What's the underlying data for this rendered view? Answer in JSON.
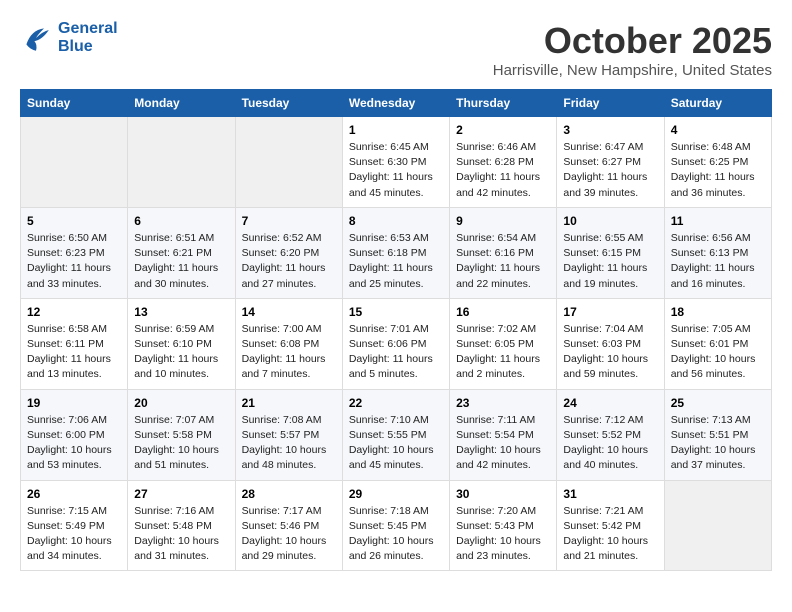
{
  "header": {
    "logo_line1": "General",
    "logo_line2": "Blue",
    "month": "October 2025",
    "location": "Harrisville, New Hampshire, United States"
  },
  "weekdays": [
    "Sunday",
    "Monday",
    "Tuesday",
    "Wednesday",
    "Thursday",
    "Friday",
    "Saturday"
  ],
  "weeks": [
    [
      {
        "num": "",
        "sunrise": "",
        "sunset": "",
        "daylight": ""
      },
      {
        "num": "",
        "sunrise": "",
        "sunset": "",
        "daylight": ""
      },
      {
        "num": "",
        "sunrise": "",
        "sunset": "",
        "daylight": ""
      },
      {
        "num": "1",
        "sunrise": "Sunrise: 6:45 AM",
        "sunset": "Sunset: 6:30 PM",
        "daylight": "Daylight: 11 hours and 45 minutes."
      },
      {
        "num": "2",
        "sunrise": "Sunrise: 6:46 AM",
        "sunset": "Sunset: 6:28 PM",
        "daylight": "Daylight: 11 hours and 42 minutes."
      },
      {
        "num": "3",
        "sunrise": "Sunrise: 6:47 AM",
        "sunset": "Sunset: 6:27 PM",
        "daylight": "Daylight: 11 hours and 39 minutes."
      },
      {
        "num": "4",
        "sunrise": "Sunrise: 6:48 AM",
        "sunset": "Sunset: 6:25 PM",
        "daylight": "Daylight: 11 hours and 36 minutes."
      }
    ],
    [
      {
        "num": "5",
        "sunrise": "Sunrise: 6:50 AM",
        "sunset": "Sunset: 6:23 PM",
        "daylight": "Daylight: 11 hours and 33 minutes."
      },
      {
        "num": "6",
        "sunrise": "Sunrise: 6:51 AM",
        "sunset": "Sunset: 6:21 PM",
        "daylight": "Daylight: 11 hours and 30 minutes."
      },
      {
        "num": "7",
        "sunrise": "Sunrise: 6:52 AM",
        "sunset": "Sunset: 6:20 PM",
        "daylight": "Daylight: 11 hours and 27 minutes."
      },
      {
        "num": "8",
        "sunrise": "Sunrise: 6:53 AM",
        "sunset": "Sunset: 6:18 PM",
        "daylight": "Daylight: 11 hours and 25 minutes."
      },
      {
        "num": "9",
        "sunrise": "Sunrise: 6:54 AM",
        "sunset": "Sunset: 6:16 PM",
        "daylight": "Daylight: 11 hours and 22 minutes."
      },
      {
        "num": "10",
        "sunrise": "Sunrise: 6:55 AM",
        "sunset": "Sunset: 6:15 PM",
        "daylight": "Daylight: 11 hours and 19 minutes."
      },
      {
        "num": "11",
        "sunrise": "Sunrise: 6:56 AM",
        "sunset": "Sunset: 6:13 PM",
        "daylight": "Daylight: 11 hours and 16 minutes."
      }
    ],
    [
      {
        "num": "12",
        "sunrise": "Sunrise: 6:58 AM",
        "sunset": "Sunset: 6:11 PM",
        "daylight": "Daylight: 11 hours and 13 minutes."
      },
      {
        "num": "13",
        "sunrise": "Sunrise: 6:59 AM",
        "sunset": "Sunset: 6:10 PM",
        "daylight": "Daylight: 11 hours and 10 minutes."
      },
      {
        "num": "14",
        "sunrise": "Sunrise: 7:00 AM",
        "sunset": "Sunset: 6:08 PM",
        "daylight": "Daylight: 11 hours and 7 minutes."
      },
      {
        "num": "15",
        "sunrise": "Sunrise: 7:01 AM",
        "sunset": "Sunset: 6:06 PM",
        "daylight": "Daylight: 11 hours and 5 minutes."
      },
      {
        "num": "16",
        "sunrise": "Sunrise: 7:02 AM",
        "sunset": "Sunset: 6:05 PM",
        "daylight": "Daylight: 11 hours and 2 minutes."
      },
      {
        "num": "17",
        "sunrise": "Sunrise: 7:04 AM",
        "sunset": "Sunset: 6:03 PM",
        "daylight": "Daylight: 10 hours and 59 minutes."
      },
      {
        "num": "18",
        "sunrise": "Sunrise: 7:05 AM",
        "sunset": "Sunset: 6:01 PM",
        "daylight": "Daylight: 10 hours and 56 minutes."
      }
    ],
    [
      {
        "num": "19",
        "sunrise": "Sunrise: 7:06 AM",
        "sunset": "Sunset: 6:00 PM",
        "daylight": "Daylight: 10 hours and 53 minutes."
      },
      {
        "num": "20",
        "sunrise": "Sunrise: 7:07 AM",
        "sunset": "Sunset: 5:58 PM",
        "daylight": "Daylight: 10 hours and 51 minutes."
      },
      {
        "num": "21",
        "sunrise": "Sunrise: 7:08 AM",
        "sunset": "Sunset: 5:57 PM",
        "daylight": "Daylight: 10 hours and 48 minutes."
      },
      {
        "num": "22",
        "sunrise": "Sunrise: 7:10 AM",
        "sunset": "Sunset: 5:55 PM",
        "daylight": "Daylight: 10 hours and 45 minutes."
      },
      {
        "num": "23",
        "sunrise": "Sunrise: 7:11 AM",
        "sunset": "Sunset: 5:54 PM",
        "daylight": "Daylight: 10 hours and 42 minutes."
      },
      {
        "num": "24",
        "sunrise": "Sunrise: 7:12 AM",
        "sunset": "Sunset: 5:52 PM",
        "daylight": "Daylight: 10 hours and 40 minutes."
      },
      {
        "num": "25",
        "sunrise": "Sunrise: 7:13 AM",
        "sunset": "Sunset: 5:51 PM",
        "daylight": "Daylight: 10 hours and 37 minutes."
      }
    ],
    [
      {
        "num": "26",
        "sunrise": "Sunrise: 7:15 AM",
        "sunset": "Sunset: 5:49 PM",
        "daylight": "Daylight: 10 hours and 34 minutes."
      },
      {
        "num": "27",
        "sunrise": "Sunrise: 7:16 AM",
        "sunset": "Sunset: 5:48 PM",
        "daylight": "Daylight: 10 hours and 31 minutes."
      },
      {
        "num": "28",
        "sunrise": "Sunrise: 7:17 AM",
        "sunset": "Sunset: 5:46 PM",
        "daylight": "Daylight: 10 hours and 29 minutes."
      },
      {
        "num": "29",
        "sunrise": "Sunrise: 7:18 AM",
        "sunset": "Sunset: 5:45 PM",
        "daylight": "Daylight: 10 hours and 26 minutes."
      },
      {
        "num": "30",
        "sunrise": "Sunrise: 7:20 AM",
        "sunset": "Sunset: 5:43 PM",
        "daylight": "Daylight: 10 hours and 23 minutes."
      },
      {
        "num": "31",
        "sunrise": "Sunrise: 7:21 AM",
        "sunset": "Sunset: 5:42 PM",
        "daylight": "Daylight: 10 hours and 21 minutes."
      },
      {
        "num": "",
        "sunrise": "",
        "sunset": "",
        "daylight": ""
      }
    ]
  ]
}
